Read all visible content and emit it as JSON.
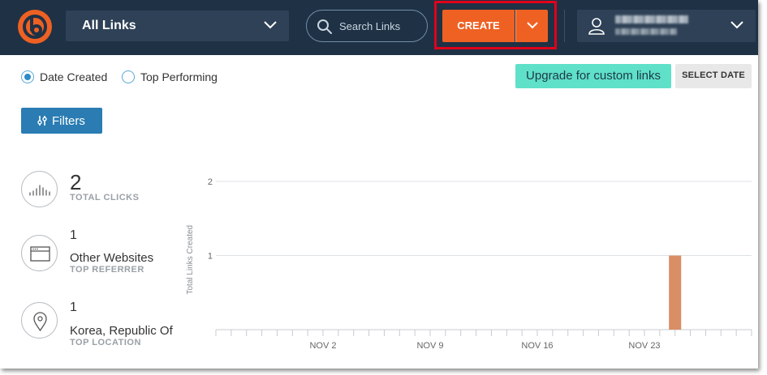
{
  "header": {
    "links_select": {
      "label": "All Links"
    },
    "search": {
      "placeholder": "Search Links"
    },
    "create": {
      "label": "CREATE"
    },
    "colors": {
      "bar": "#1f3145",
      "accent": "#ee6123"
    }
  },
  "controls": {
    "sort_options": [
      {
        "label": "Date Created",
        "selected": true
      },
      {
        "label": "Top Performing",
        "selected": false
      }
    ],
    "upgrade_label": "Upgrade for custom links",
    "select_date_label": "SELECT DATE",
    "filters_label": "Filters"
  },
  "stats": [
    {
      "value": "2",
      "caption": "TOTAL CLICKS",
      "icon": "bars-icon"
    },
    {
      "value": "1",
      "name": "Other Websites",
      "caption": "TOP REFERRER",
      "icon": "browser-window-icon"
    },
    {
      "value": "1",
      "name": "Korea, Republic Of",
      "caption": "TOP LOCATION",
      "icon": "location-pin-icon"
    }
  ],
  "chart_data": {
    "type": "bar",
    "ylabel": "Total Links Created",
    "ylim": [
      0,
      2
    ],
    "yticks": [
      1,
      2
    ],
    "xticks": [
      {
        "label": "NOV 2",
        "day": 2
      },
      {
        "label": "NOV 9",
        "day": 9
      },
      {
        "label": "NOV 16",
        "day": 16
      },
      {
        "label": "NOV 23",
        "day": 23
      }
    ],
    "xrange_days": [
      -5,
      30
    ],
    "bars": [
      {
        "day": 25,
        "value": 1
      }
    ],
    "bar_color": "#d98e66",
    "grid": true
  }
}
